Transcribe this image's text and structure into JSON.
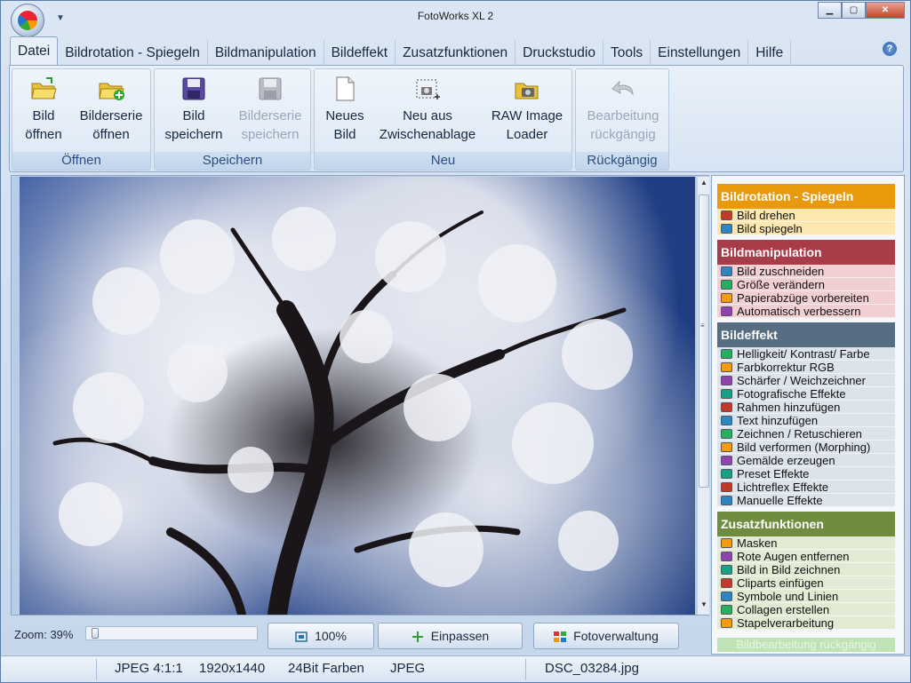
{
  "window": {
    "title": "FotoWorks XL 2",
    "buttons": [
      "minimize",
      "maximize",
      "close"
    ],
    "min_glyph": "▁",
    "max_glyph": "▢",
    "close_glyph": "✕",
    "qa_glyph": "▼"
  },
  "tabs": [
    "Datei",
    "Bildrotation - Spiegeln",
    "Bildmanipulation",
    "Bildeffekt",
    "Zusatzfunktionen",
    "Druckstudio",
    "Tools",
    "Einstellungen",
    "Hilfe"
  ],
  "help_glyph": "?",
  "ribbon": {
    "oeffnen": {
      "label": "Öffnen",
      "buttons": [
        {
          "line1": "Bild",
          "line2": "öffnen"
        },
        {
          "line1": "Bilderserie",
          "line2": "öffnen"
        }
      ]
    },
    "speichern": {
      "label": "Speichern",
      "buttons": [
        {
          "line1": "Bild",
          "line2": "speichern"
        },
        {
          "line1": "Bilderserie",
          "line2": "speichern"
        }
      ]
    },
    "neu": {
      "label": "Neu",
      "buttons": [
        {
          "line1": "Neues",
          "line2": "Bild"
        },
        {
          "line1": "Neu aus",
          "line2": "Zwischenablage"
        },
        {
          "line1": "RAW Image",
          "line2": "Loader"
        }
      ]
    },
    "rueckgaengig": {
      "label": "Rückgängig",
      "buttons": [
        {
          "line1": "Bearbeitung",
          "line2": "rückgängig"
        }
      ]
    }
  },
  "zoom": {
    "label": "Zoom: 39%",
    "level_percent": 39,
    "btn_100": "100%",
    "btn_fit": "Einpassen",
    "btn_manage": "Fotoverwaltung"
  },
  "panel": {
    "sections": [
      {
        "title": "Bildrotation - Spiegeln",
        "color": "#e89a0c",
        "bg": "#fde7b0",
        "items": [
          "Bild drehen",
          "Bild spiegeln"
        ]
      },
      {
        "title": "Bildmanipulation",
        "color": "#a83c48",
        "bg": "#f1cfd3",
        "items": [
          "Bild zuschneiden",
          "Größe verändern",
          "Papierabzüge vorbereiten",
          "Automatisch verbessern"
        ]
      },
      {
        "title": "Bildeffekt",
        "color": "#566d82",
        "bg": "#dde3ea",
        "items": [
          "Helligkeit/ Kontrast/ Farbe",
          "Farbkorrektur RGB",
          "Schärfer / Weichzeichner",
          "Fotografische Effekte",
          "Rahmen hinzufügen",
          "Text hinzufügen",
          "Zeichnen / Retuschieren",
          "Bild verformen (Morphing)",
          "Gemälde erzeugen",
          "Preset Effekte",
          "Lichtreflex Effekte",
          "Manuelle Effekte"
        ]
      },
      {
        "title": "Zusatzfunktionen",
        "color": "#6f8c3f",
        "bg": "#e2ead3",
        "items": [
          "Masken",
          "Rote Augen entfernen",
          "Bild in Bild zeichnen",
          "Cliparts einfügen",
          "Symbole und Linien",
          "Collagen erstellen",
          "Stapelverarbeitung"
        ]
      }
    ],
    "undo_label": "Bildbearbeitung rückgängig"
  },
  "status": {
    "format": "JPEG  4:1:1",
    "size": "1920x1440",
    "depth": "24Bit Farben",
    "type": "JPEG",
    "file": "DSC_03284.jpg"
  }
}
